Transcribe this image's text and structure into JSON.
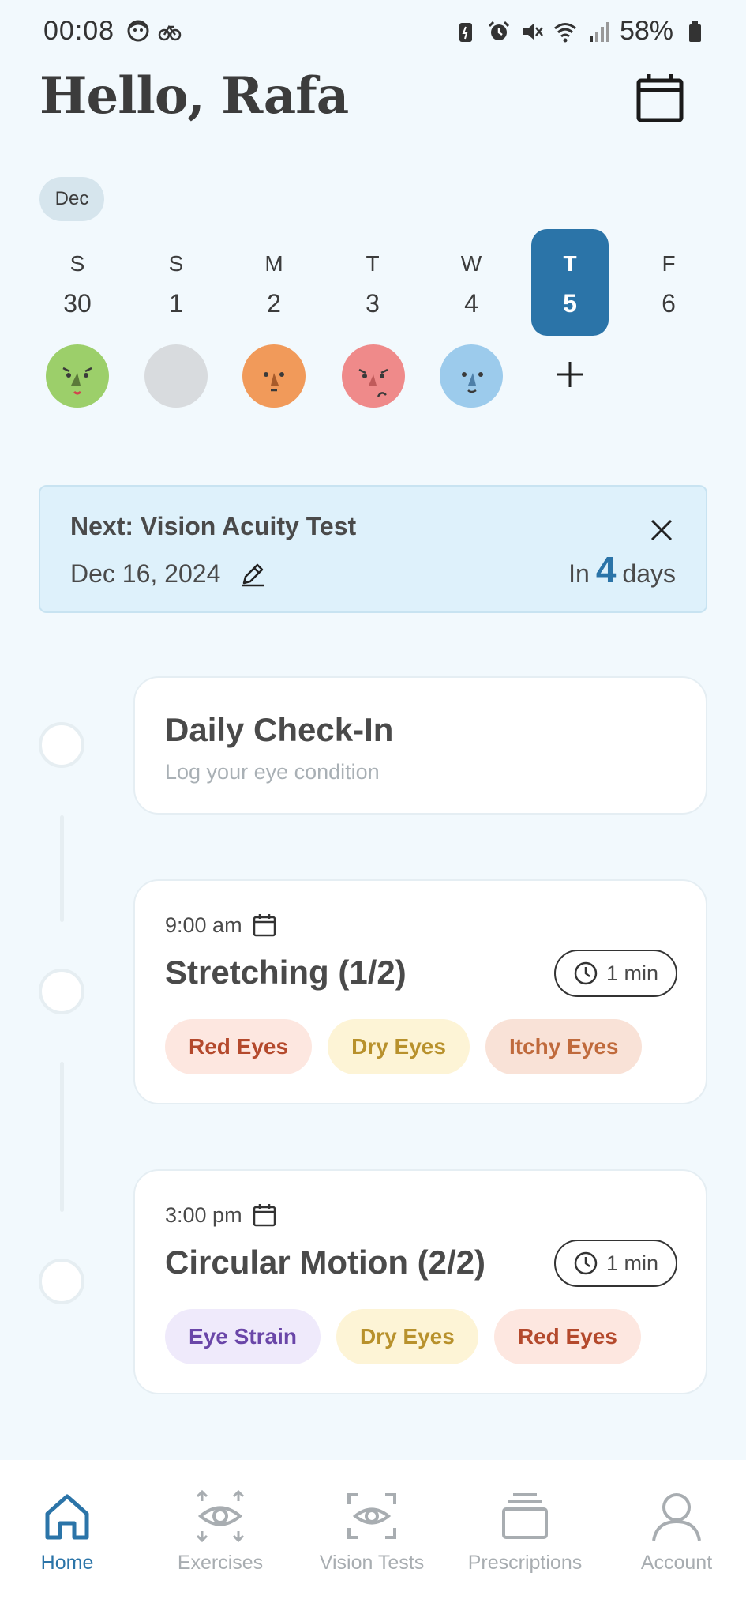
{
  "status_bar": {
    "time": "00:08",
    "battery": "58%"
  },
  "header": {
    "greeting": "Hello, Rafa",
    "calendar_icon": "calendar-icon"
  },
  "calendar": {
    "month": "Dec",
    "days": [
      {
        "letter": "S",
        "number": "30"
      },
      {
        "letter": "S",
        "number": "1"
      },
      {
        "letter": "M",
        "number": "2"
      },
      {
        "letter": "T",
        "number": "3"
      },
      {
        "letter": "W",
        "number": "4"
      },
      {
        "letter": "T",
        "number": "5",
        "selected": true
      },
      {
        "letter": "F",
        "number": "6"
      }
    ],
    "moods": [
      "green-sick-face",
      "empty",
      "orange-face",
      "red-sad-face",
      "blue-face"
    ],
    "add_mood_icon": "plus-icon"
  },
  "next_test": {
    "title": "Next: Vision Acuity Test",
    "date": "Dec 16, 2024",
    "in_prefix": "In",
    "days_count": "4",
    "days_suffix": "days"
  },
  "tasks": [
    {
      "title": "Daily Check-In",
      "subtitle": "Log your eye condition"
    },
    {
      "time": "9:00 am",
      "title": "Stretching (1/2)",
      "duration": "1 min",
      "tags": [
        "Red Eyes",
        "Dry Eyes",
        "Itchy Eyes"
      ]
    },
    {
      "time": "3:00 pm",
      "title": "Circular Motion (2/2)",
      "duration": "1 min",
      "tags": [
        "Eye Strain",
        "Dry Eyes",
        "Red Eyes"
      ]
    }
  ],
  "nav": {
    "items": [
      {
        "label": "Home",
        "icon": "home-icon",
        "active": true
      },
      {
        "label": "Exercises",
        "icon": "eye-arrows-icon"
      },
      {
        "label": "Vision Tests",
        "icon": "eye-scan-icon"
      },
      {
        "label": "Prescriptions",
        "icon": "stack-icon"
      },
      {
        "label": "Account",
        "icon": "person-icon"
      }
    ]
  },
  "colors": {
    "accent": "#2b74a8",
    "background": "#f2f9fd",
    "banner": "#def1fb"
  }
}
